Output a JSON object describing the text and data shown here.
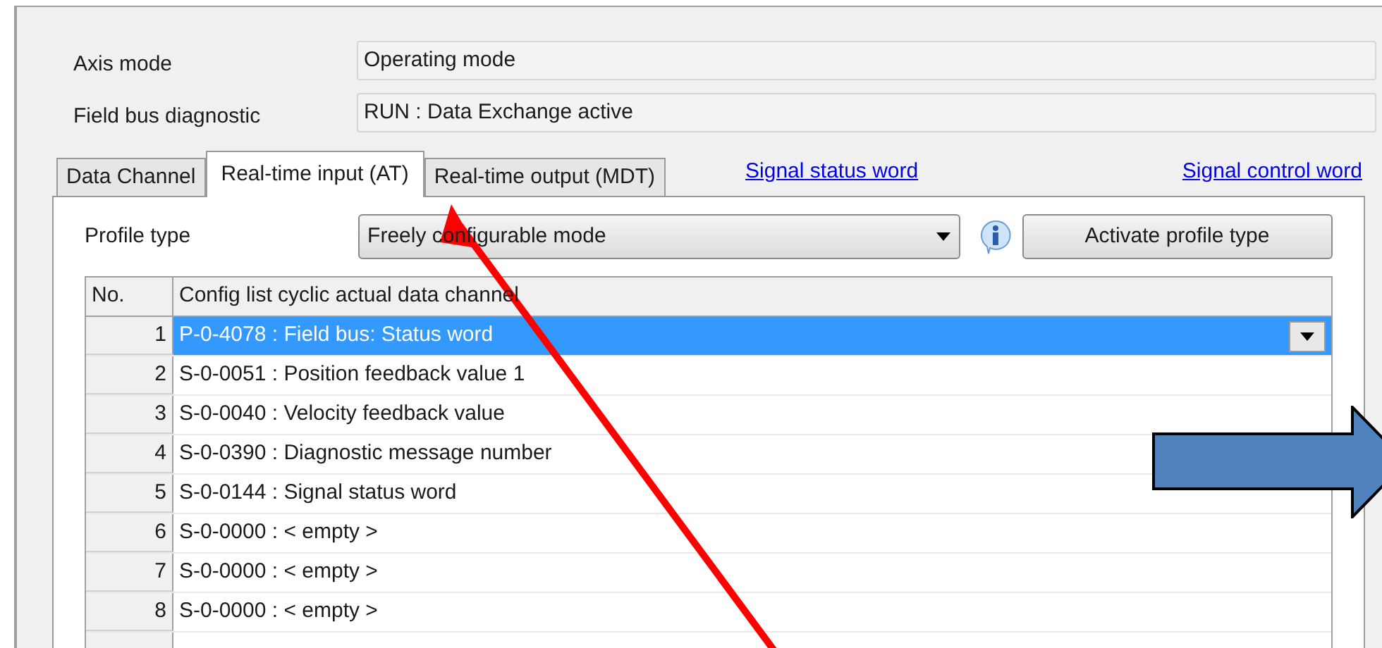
{
  "fields": [
    {
      "label": "Axis mode",
      "value": "Operating mode"
    },
    {
      "label": "Field bus diagnostic",
      "value": "RUN : Data Exchange active"
    }
  ],
  "tabs": [
    {
      "label": "Data Channel",
      "selected": false
    },
    {
      "label": "Real-time input (AT)",
      "selected": true
    },
    {
      "label": "Real-time output (MDT)",
      "selected": false
    }
  ],
  "links": [
    "Signal status word",
    "Signal control word"
  ],
  "profile": {
    "label": "Profile type",
    "value": "Freely configurable mode",
    "button": "Activate profile type"
  },
  "table": {
    "columns": [
      "No.",
      "Config list cyclic actual data channel"
    ],
    "rows": [
      {
        "no": "1",
        "value": "P-0-4078 : Field bus: Status word",
        "selected": true
      },
      {
        "no": "2",
        "value": "S-0-0051 : Position feedback value 1",
        "selected": false
      },
      {
        "no": "3",
        "value": "S-0-0040 : Velocity feedback value",
        "selected": false
      },
      {
        "no": "4",
        "value": "S-0-0390 : Diagnostic message number",
        "selected": false
      },
      {
        "no": "5",
        "value": "S-0-0144 : Signal status word",
        "selected": false
      },
      {
        "no": "6",
        "value": "S-0-0000 : < empty >",
        "selected": false
      },
      {
        "no": "7",
        "value": "S-0-0000 : < empty >",
        "selected": false
      },
      {
        "no": "8",
        "value": "S-0-0000 : < empty >",
        "selected": false
      }
    ]
  }
}
